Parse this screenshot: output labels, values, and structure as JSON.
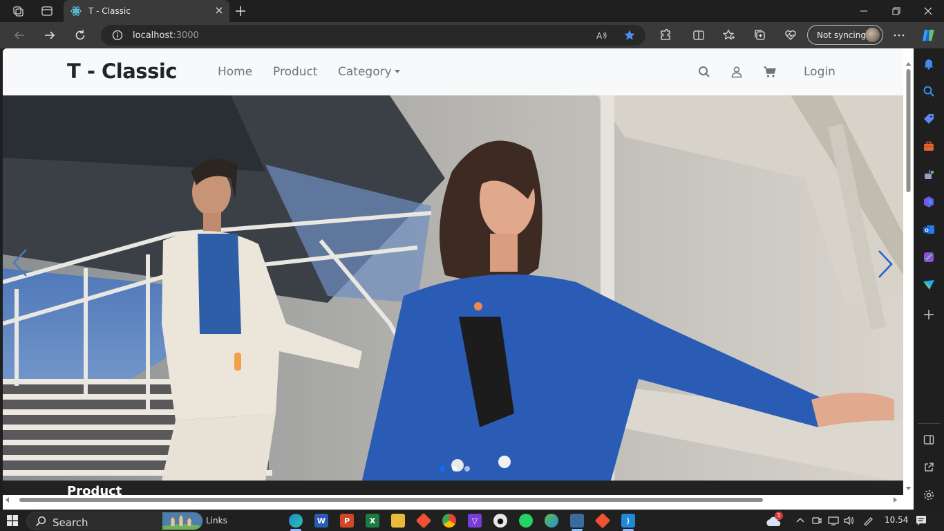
{
  "browser": {
    "tab_title": "T - Classic",
    "url_host": "localhost",
    "url_port": ":3000",
    "sync_label": "Not syncing"
  },
  "site": {
    "brand": "T - Classic",
    "nav": {
      "home": "Home",
      "product": "Product",
      "category": "Category"
    },
    "login": "Login",
    "below_heading": "Product"
  },
  "carousel": {
    "slide_count": 3,
    "active_index": 0
  },
  "taskbar": {
    "search_label": "Search",
    "links_label": "Links",
    "time": "10.54",
    "weather_badge": "1"
  },
  "colors": {
    "accent": "#0d6efd",
    "jacket_blue": "#2a5bb5",
    "brand_text": "#212529",
    "muted_text": "#6c757d"
  }
}
